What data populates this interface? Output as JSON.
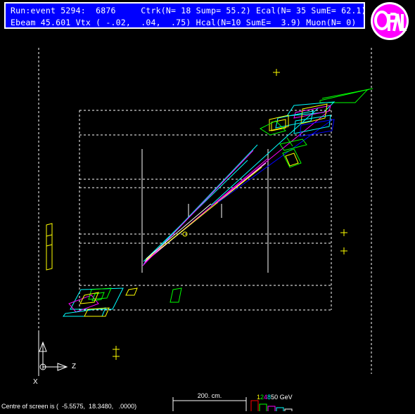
{
  "header": {
    "line1": "Run:event 5294:  6876     Ctrk(N= 18 Sump= 55.2) Ecal(N= 35 SumE= 62.1)",
    "line2": "Ebeam 45.601 Vtx ( -.02,  .04,  .75) Hcal(N=10 SumE=  3.9) Muon(N= 0)"
  },
  "logo": {
    "text": "OPAL"
  },
  "footer": {
    "centre_text": "Centre of screen is (  -5.5575,  18.3480,   .0000)",
    "scale_label": "200. cm.",
    "energy_labels": [
      "1",
      "2",
      "4",
      "8",
      "50 GeV"
    ],
    "energy_colors": [
      "#ffff00",
      "#00ff00",
      "#ff00ff",
      "#00ffff",
      "#ffffff"
    ]
  },
  "axes": {
    "z_label": "Z",
    "x_label": "X"
  },
  "colors": {
    "header_bg": "#0000ff",
    "logo_bg": "#ff00ff",
    "track": "#00ffff",
    "ecal": "#ffff00",
    "hcal": "#00ff00"
  }
}
